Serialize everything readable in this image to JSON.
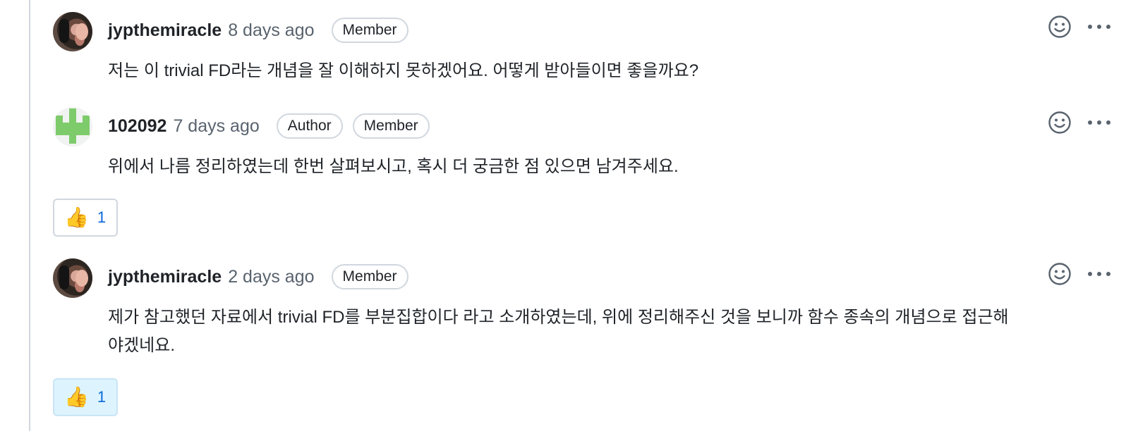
{
  "comments": [
    {
      "author": "jypthemiracle",
      "time": "8 days ago",
      "badges": [
        "Member"
      ],
      "body": "저는 이 trivial FD라는 개념을 잘 이해하지 못하겠어요. 어떻게 받아들이면 좋을까요?",
      "avatar": "photo-avatar"
    },
    {
      "author": "102092",
      "time": "7 days ago",
      "badges": [
        "Author",
        "Member"
      ],
      "body": "위에서 나름 정리하였는데 한번 살펴보시고, 혹시 더 궁금한 점 있으면 남겨주세요.",
      "avatar": "identicon-avatar",
      "reaction": {
        "emoji": "👍",
        "count": "1",
        "selected": false
      }
    },
    {
      "author": "jypthemiracle",
      "time": "2 days ago",
      "badges": [
        "Member"
      ],
      "body_line1": "제가 참고했던 자료에서 trivial FD를 부분집합이다 라고 소개하였는데, 위에 정리해주신 것을 보니까 함수 종속의 개념으로 접근해",
      "body_line2": "야겠네요.",
      "avatar": "photo-avatar",
      "reaction": {
        "emoji": "👍",
        "count": "1",
        "selected": true
      }
    }
  ],
  "colors": {
    "text": "#1f2328",
    "muted": "#59636e",
    "border": "#d0d7de",
    "reaction_active_bg": "#ddf4ff",
    "link": "#0969da",
    "identicon": "#7ecb6b"
  },
  "icons": {
    "emoji": "smiley-icon",
    "more": "kebab-horizontal-icon",
    "reaction": "thumbs-up-icon"
  }
}
